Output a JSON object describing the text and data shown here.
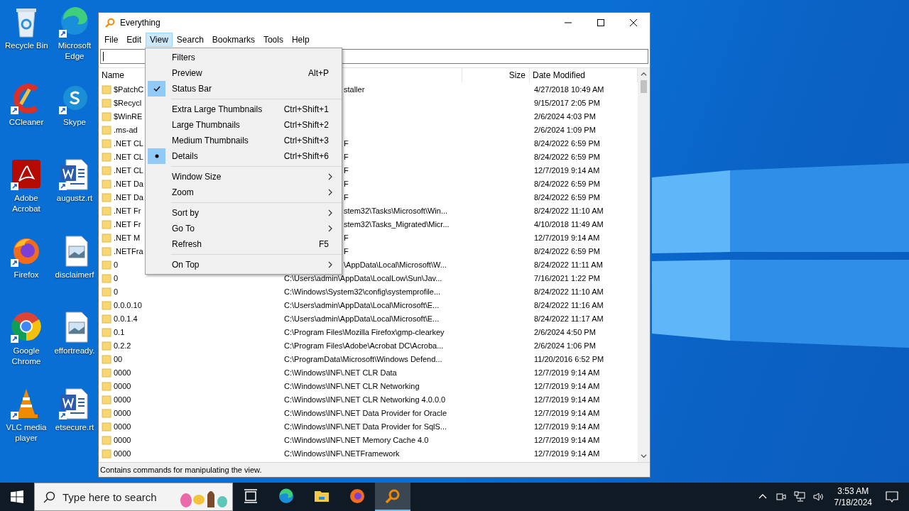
{
  "desktop_icons": [
    {
      "label": "Recycle Bin",
      "kind": "recycle"
    },
    {
      "label": "Microsoft Edge",
      "kind": "edge"
    },
    {
      "label": "CCleaner",
      "kind": "ccleaner"
    },
    {
      "label": "Skype",
      "kind": "skype"
    },
    {
      "label": "Adobe Acrobat",
      "kind": "acrobat"
    },
    {
      "label": "augustz.rt",
      "kind": "word"
    },
    {
      "label": "Firefox",
      "kind": "firefox"
    },
    {
      "label": "disclaimerf",
      "kind": "image"
    },
    {
      "label": "Google Chrome",
      "kind": "chrome"
    },
    {
      "label": "effortready.",
      "kind": "image"
    },
    {
      "label": "VLC media player",
      "kind": "vlc"
    },
    {
      "label": "etsecure.rt",
      "kind": "word"
    }
  ],
  "window": {
    "title": "Everything",
    "menu": [
      {
        "label": "File",
        "selected": false
      },
      {
        "label": "Edit",
        "selected": false
      },
      {
        "label": "View",
        "selected": true
      },
      {
        "label": "Search",
        "selected": false
      },
      {
        "label": "Bookmarks",
        "selected": false
      },
      {
        "label": "Tools",
        "selected": false
      },
      {
        "label": "Help",
        "selected": false
      }
    ],
    "columns": [
      {
        "label": "Name"
      },
      {
        "label": "Size"
      },
      {
        "label": "Date Modified"
      }
    ],
    "rows": [
      {
        "name": "$PatchC",
        "path": "staller",
        "date": "4/27/2018 10:49 AM"
      },
      {
        "name": "$Recycl",
        "date": "9/15/2017 2:05 PM"
      },
      {
        "name": "$WinRE",
        "date": "2/6/2024 4:03 PM"
      },
      {
        "name": ".ms-ad",
        "date": "2/6/2024 1:09 PM"
      },
      {
        "name": ".NET CL",
        "path": "F",
        "date": "8/24/2022 6:59 PM"
      },
      {
        "name": ".NET CL",
        "path": "F",
        "date": "8/24/2022 6:59 PM"
      },
      {
        "name": ".NET CL",
        "path": "F",
        "date": "12/7/2019 9:14 AM"
      },
      {
        "name": ".NET Da",
        "path": "F",
        "date": "8/24/2022 6:59 PM"
      },
      {
        "name": ".NET Da",
        "path": "F",
        "date": "8/24/2022 6:59 PM"
      },
      {
        "name": ".NET Fr",
        "path": "stem32\\Tasks\\Microsoft\\Win...",
        "date": "8/24/2022 11:10 AM"
      },
      {
        "name": ".NET Fr",
        "path": "stem32\\Tasks_Migrated\\Micr...",
        "date": "4/10/2018 11:49 AM"
      },
      {
        "name": ".NET M",
        "path": "F",
        "date": "12/7/2019 9:14 AM"
      },
      {
        "name": ".NETFra",
        "path": "F",
        "date": "8/24/2022 6:59 PM"
      },
      {
        "name": "0",
        "path": "\\AppData\\Local\\Microsoft\\W...",
        "date": "8/24/2022 11:11 AM"
      },
      {
        "name": "0",
        "path": "C:\\Users\\admin\\AppData\\LocalLow\\Sun\\Jav...",
        "date": "7/16/2021 1:22 PM"
      },
      {
        "name": "0",
        "path": "C:\\Windows\\System32\\config\\systemprofile...",
        "date": "8/24/2022 11:10 AM"
      },
      {
        "name": "0.0.0.10",
        "path": "C:\\Users\\admin\\AppData\\Local\\Microsoft\\E...",
        "date": "8/24/2022 11:16 AM"
      },
      {
        "name": "0.0.1.4",
        "path": "C:\\Users\\admin\\AppData\\Local\\Microsoft\\E...",
        "date": "8/24/2022 11:17 AM"
      },
      {
        "name": "0.1",
        "path": "C:\\Program Files\\Mozilla Firefox\\gmp-clearkey",
        "date": "2/6/2024 4:50 PM"
      },
      {
        "name": "0.2.2",
        "path": "C:\\Program Files\\Adobe\\Acrobat DC\\Acroba...",
        "date": "2/6/2024 1:06 PM"
      },
      {
        "name": "00",
        "path": "C:\\ProgramData\\Microsoft\\Windows Defend...",
        "date": "11/20/2016 6:52 PM"
      },
      {
        "name": "0000",
        "path": "C:\\Windows\\INF\\.NET CLR Data",
        "date": "12/7/2019 9:14 AM"
      },
      {
        "name": "0000",
        "path": "C:\\Windows\\INF\\.NET CLR Networking",
        "date": "12/7/2019 9:14 AM"
      },
      {
        "name": "0000",
        "path": "C:\\Windows\\INF\\.NET CLR Networking 4.0.0.0",
        "date": "12/7/2019 9:14 AM"
      },
      {
        "name": "0000",
        "path": "C:\\Windows\\INF\\.NET Data Provider for Oracle",
        "date": "12/7/2019 9:14 AM"
      },
      {
        "name": "0000",
        "path": "C:\\Windows\\INF\\.NET Data Provider for SqlS...",
        "date": "12/7/2019 9:14 AM"
      },
      {
        "name": "0000",
        "path": "C:\\Windows\\INF\\.NET Memory Cache 4.0",
        "date": "12/7/2019 9:14 AM"
      },
      {
        "name": "0000",
        "path": "C:\\Windows\\INF\\.NETFramework",
        "date": "12/7/2019 9:14 AM"
      }
    ],
    "status_bar": "Contains commands for manipulating the view."
  },
  "view_menu": {
    "sections": [
      [
        {
          "label": "Filters",
          "kind": "command",
          "checked": false
        },
        {
          "label": "Preview",
          "kind": "command",
          "shortcut": "Alt+P",
          "checked": false
        },
        {
          "label": "Status Bar",
          "kind": "check",
          "checked": true
        }
      ],
      [
        {
          "label": "Extra Large Thumbnails",
          "kind": "radio",
          "shortcut": "Ctrl+Shift+1",
          "checked": false
        },
        {
          "label": "Large Thumbnails",
          "kind": "radio",
          "shortcut": "Ctrl+Shift+2",
          "checked": false
        },
        {
          "label": "Medium Thumbnails",
          "kind": "radio",
          "shortcut": "Ctrl+Shift+3",
          "checked": false
        },
        {
          "label": "Details",
          "kind": "radio",
          "shortcut": "Ctrl+Shift+6",
          "checked": true
        }
      ],
      [
        {
          "label": "Window Size",
          "kind": "submenu",
          "checked": false
        },
        {
          "label": "Zoom",
          "kind": "submenu",
          "checked": false
        }
      ],
      [
        {
          "label": "Sort by",
          "kind": "submenu",
          "checked": false
        },
        {
          "label": "Go To",
          "kind": "submenu",
          "checked": false
        },
        {
          "label": "Refresh",
          "kind": "command",
          "shortcut": "F5",
          "checked": false
        }
      ],
      [
        {
          "label": "On Top",
          "kind": "submenu",
          "checked": false
        }
      ]
    ]
  },
  "taskbar": {
    "search_placeholder": "Type here to search",
    "apps": [
      {
        "kind": "taskview",
        "selected": false
      },
      {
        "kind": "edge",
        "selected": false
      },
      {
        "kind": "folder",
        "selected": false
      },
      {
        "kind": "firefox",
        "selected": false
      },
      {
        "kind": "everything",
        "selected": true
      }
    ],
    "clock": {
      "time": "3:53 AM",
      "date": "7/18/2024"
    }
  }
}
